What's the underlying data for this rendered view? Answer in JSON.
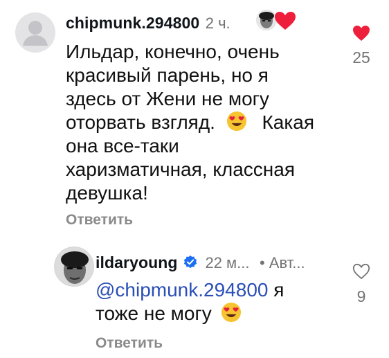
{
  "comments": [
    {
      "username": "chipmunk.294800",
      "time": "2 ч.",
      "text_lines": [
        "Ильдар, конечно, очень",
        "красивый парень, но я",
        "здесь от Жени не могу",
        "оторвать взгляд.",
        "Какая",
        "она все-таки",
        "харизматичная, классная",
        "девушка!"
      ],
      "reply_label": "Ответить",
      "like_count": "25",
      "liked": true,
      "icons": [
        "heart-filled-icon",
        "heart-eyes-emoji"
      ]
    }
  ],
  "replies": [
    {
      "username": "ildaryoung",
      "verified": true,
      "time": "22 м...",
      "author_badge": "• Авт...",
      "mention": "@chipmunk.294800",
      "text_after_mention": " я",
      "text_line2": "тоже не могу",
      "reply_label": "Ответить",
      "like_count": "9",
      "liked": false,
      "icons": [
        "verified-badge-icon",
        "heart-outline-icon",
        "heart-eyes-emoji"
      ]
    }
  ],
  "colors": {
    "heart": "#ed1f3a",
    "verified": "#1d6ff2",
    "mention": "#2a4fb7",
    "meta": "#737373"
  }
}
